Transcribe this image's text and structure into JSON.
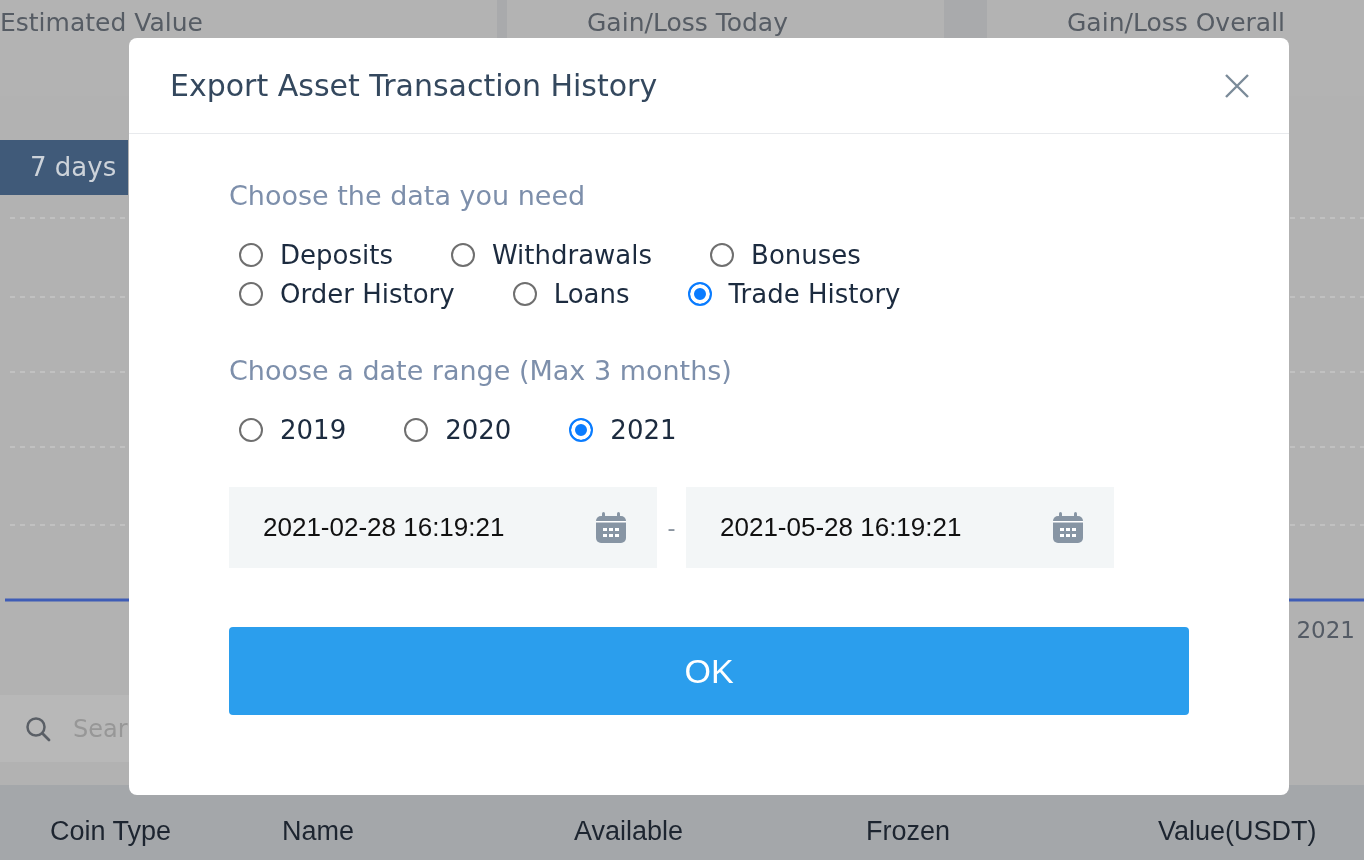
{
  "background": {
    "summary_cards": [
      {
        "title": "Estimated Value"
      },
      {
        "title": "Gain/Loss Today"
      },
      {
        "title": "Gain/Loss Overall"
      }
    ],
    "range_tabs": [
      {
        "label": "7 days",
        "selected": true
      }
    ],
    "chart": {
      "axis_label": "2021"
    },
    "search": {
      "placeholder": "Sear"
    },
    "table": {
      "columns": [
        "Coin Type",
        "Name",
        "Available",
        "Frozen",
        "Value(USDT)"
      ]
    }
  },
  "dialog": {
    "title": "Export Asset Transaction History",
    "data_section": {
      "heading": "Choose the data you need",
      "option_rows": [
        {
          "options": [
            {
              "label": "Deposits",
              "selected": false
            },
            {
              "label": "Withdrawals",
              "selected": false
            },
            {
              "label": "Bonuses",
              "selected": false
            }
          ]
        },
        {
          "options": [
            {
              "label": "Order History",
              "selected": false
            },
            {
              "label": "Loans",
              "selected": false
            },
            {
              "label": "Trade History",
              "selected": true
            }
          ]
        }
      ]
    },
    "date_section": {
      "heading": "Choose a date range (Max 3 months)",
      "years": [
        {
          "label": "2019",
          "selected": false
        },
        {
          "label": "2020",
          "selected": false
        },
        {
          "label": "2021",
          "selected": true
        }
      ],
      "start": "2021-02-28 16:19:21",
      "separator": "-",
      "end": "2021-05-28 16:19:21"
    },
    "button": "OK"
  }
}
